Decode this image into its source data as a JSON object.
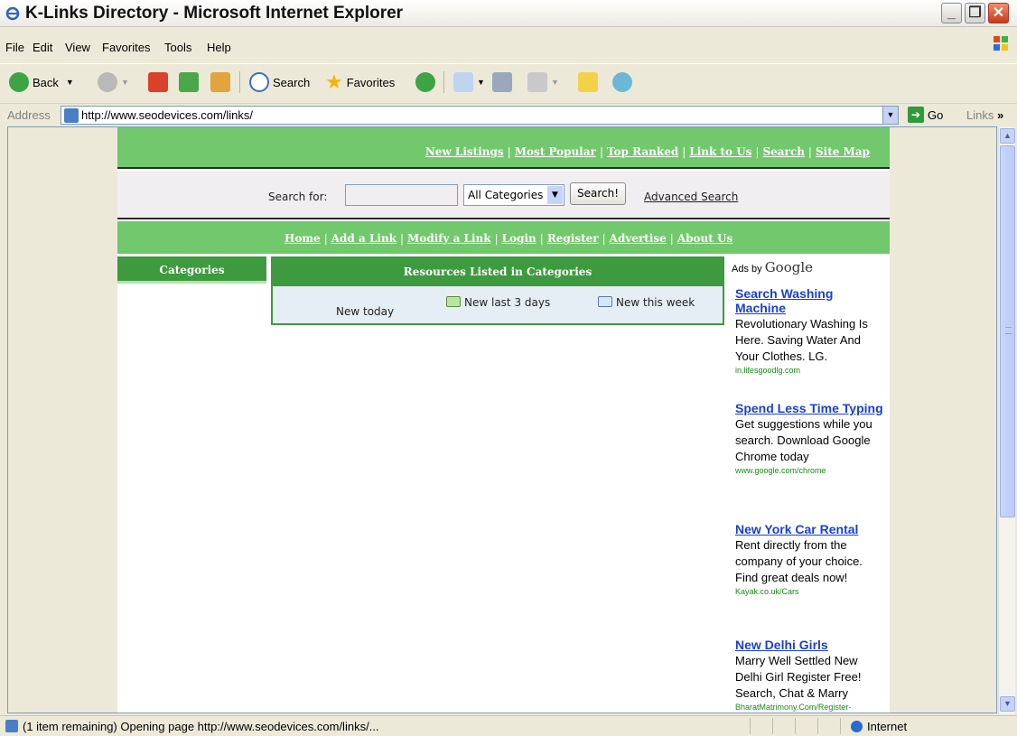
{
  "window": {
    "title": "K-Links Directory - Microsoft Internet Explorer"
  },
  "menu": [
    "File",
    "Edit",
    "View",
    "Favorites",
    "Tools",
    "Help"
  ],
  "toolbar": {
    "back": "Back",
    "search": "Search",
    "favorites": "Favorites"
  },
  "address": {
    "label": "Address",
    "url": "http://www.seodevices.com/links/",
    "go": "Go",
    "links": "Links"
  },
  "site": {
    "top_links": [
      "New Listings",
      "Most Popular",
      "Top Ranked",
      "Link to Us",
      "Search",
      "Site Map"
    ],
    "search": {
      "label": "Search for:",
      "category": "All Categories",
      "button": "Search!",
      "advanced": "Advanced Search"
    },
    "mid_links": [
      "Home",
      "Add a Link",
      "Modify a Link",
      "Login",
      "Register",
      "Advertise",
      "About Us"
    ],
    "categories_tab": "Categories",
    "resources": {
      "header": "Resources Listed in Categories",
      "new_today": "New today",
      "new_3days": "New last 3 days",
      "new_week": "New this week"
    }
  },
  "ads": {
    "header_prefix": "Ads by",
    "header_brand": "Google",
    "items": [
      {
        "title": "Search Washing Machine",
        "body": "Revolutionary Washing Is Here. Saving Water And Your Clothes. LG.",
        "url": "in.lifesgoodlg.com"
      },
      {
        "title": "Spend Less Time Typing",
        "body": "Get suggestions while you search. Download Google Chrome today",
        "url": "www.google.com/chrome"
      },
      {
        "title": "New York Car Rental",
        "body": "Rent directly from the company of your choice. Find great deals now!",
        "url": "Kayak.co.uk/Cars"
      },
      {
        "title": "New Delhi Girls",
        "body": "Marry Well Settled New Delhi Girl Register Free! Search, Chat & Marry",
        "url": "BharatMatrimony.Com/Register-"
      }
    ]
  },
  "status": {
    "text": "(1 item remaining) Opening page http://www.seodevices.com/links/...",
    "zone": "Internet"
  }
}
